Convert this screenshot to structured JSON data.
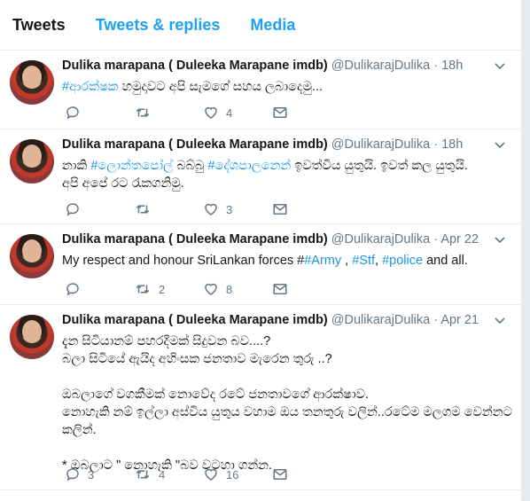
{
  "tabs": [
    {
      "label": "Tweets",
      "active": true
    },
    {
      "label": "Tweets & replies",
      "active": false
    },
    {
      "label": "Media",
      "active": false
    }
  ],
  "colors": {
    "accent": "#1da1f2",
    "text": "#14171a",
    "muted": "#657786",
    "border": "#e6ecf0"
  },
  "tweets": [
    {
      "name": "Dulika marapana ( Duleeka Marapane imdb)",
      "handle": "@DulikarajDulika",
      "time": "18h",
      "segments": [
        [
          "#ආරක්ෂක",
          true
        ],
        [
          " හමුදාවට අපි සැමගේ සහය ලබාදෙමු...",
          false
        ]
      ],
      "replies": "",
      "retweets": "",
      "likes": "4"
    },
    {
      "name": "Dulika marapana ( Duleeka Marapane imdb)",
      "handle": "@DulikarajDulika",
      "time": "18h",
      "segments": [
        [
          "නාකි ",
          false
        ],
        [
          "#ලොන්තපෝල්",
          true
        ],
        [
          " බබ්බු ",
          false
        ],
        [
          "#දේශපාලනෙන්",
          true
        ],
        [
          " ඉවත්විය යුතුයි. ඉවත් කල යුතුයි.\nඅපි අපේ රට රැකගනිමු.",
          false
        ]
      ],
      "replies": "",
      "retweets": "",
      "likes": "3"
    },
    {
      "name": "Dulika marapana ( Duleeka Marapane imdb)",
      "handle": "@DulikarajDulika",
      "time": "Apr 22",
      "segments": [
        [
          "My respect and honour SriLankan forces #",
          false
        ],
        [
          "#Army",
          true
        ],
        [
          " , ",
          false
        ],
        [
          "#Stf",
          true
        ],
        [
          ", ",
          false
        ],
        [
          "#police",
          true
        ],
        [
          " and all.",
          false
        ]
      ],
      "replies": "",
      "retweets": "2",
      "likes": "8"
    },
    {
      "name": "Dulika marapana ( Duleeka Marapane imdb)",
      "handle": "@DulikarajDulika",
      "time": "Apr 21",
      "segments": [
        [
          "දැන සිටියානම් පහරදීමක් සිදුවන බව....?\nබලා සිටියේ ඇයිද අහිංසක ජනතාව මැරෙන තුරු ..?\n\nඔබලාගේ වගකීමක් නොවේද රටේ ජනතාවගේ ආරක්ෂාව.\nනොහැකි නම් ඉල්ලා අස්විය යුතුය වහාම ඔය තනතුරු වලින්..රටේම මලගම වෙන්නට කලින්.\n\n* ඔබලාට \" නොහැකි \"බව වටහා ගන්න.",
          false
        ]
      ],
      "replies": "3",
      "retweets": "4",
      "likes": "16"
    }
  ]
}
